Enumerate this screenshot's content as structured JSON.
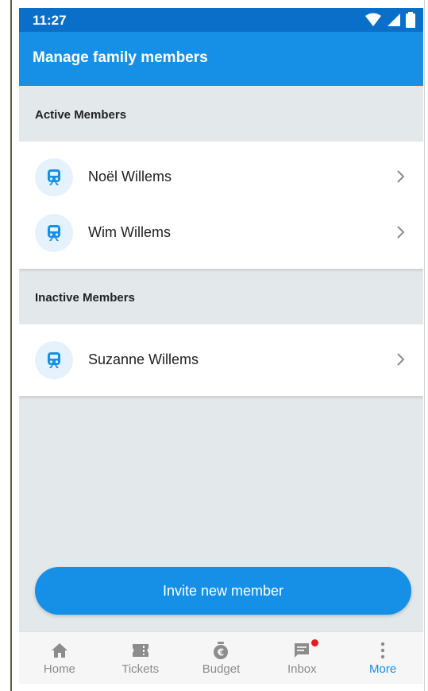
{
  "status_bar": {
    "time": "11:27"
  },
  "app_bar": {
    "title": "Manage family members"
  },
  "sections": {
    "active": {
      "title": "Active Members",
      "members": [
        {
          "name": "Noël Willems"
        },
        {
          "name": "Wim Willems"
        }
      ]
    },
    "inactive": {
      "title": "Inactive Members",
      "members": [
        {
          "name": "Suzanne Willems"
        }
      ]
    }
  },
  "invite_button": {
    "label": "Invite new member"
  },
  "bottom_nav": {
    "items": [
      {
        "label": "Home",
        "icon": "home-icon"
      },
      {
        "label": "Tickets",
        "icon": "ticket-icon"
      },
      {
        "label": "Budget",
        "icon": "money-bag-icon"
      },
      {
        "label": "Inbox",
        "icon": "inbox-icon"
      },
      {
        "label": "More",
        "icon": "more-vertical-icon"
      }
    ],
    "active_item": "More"
  },
  "colors": {
    "primary": "#1590e6",
    "status_bar": "#0a6fc8",
    "background": "#e3e8eb",
    "badge": "#e31b23"
  }
}
